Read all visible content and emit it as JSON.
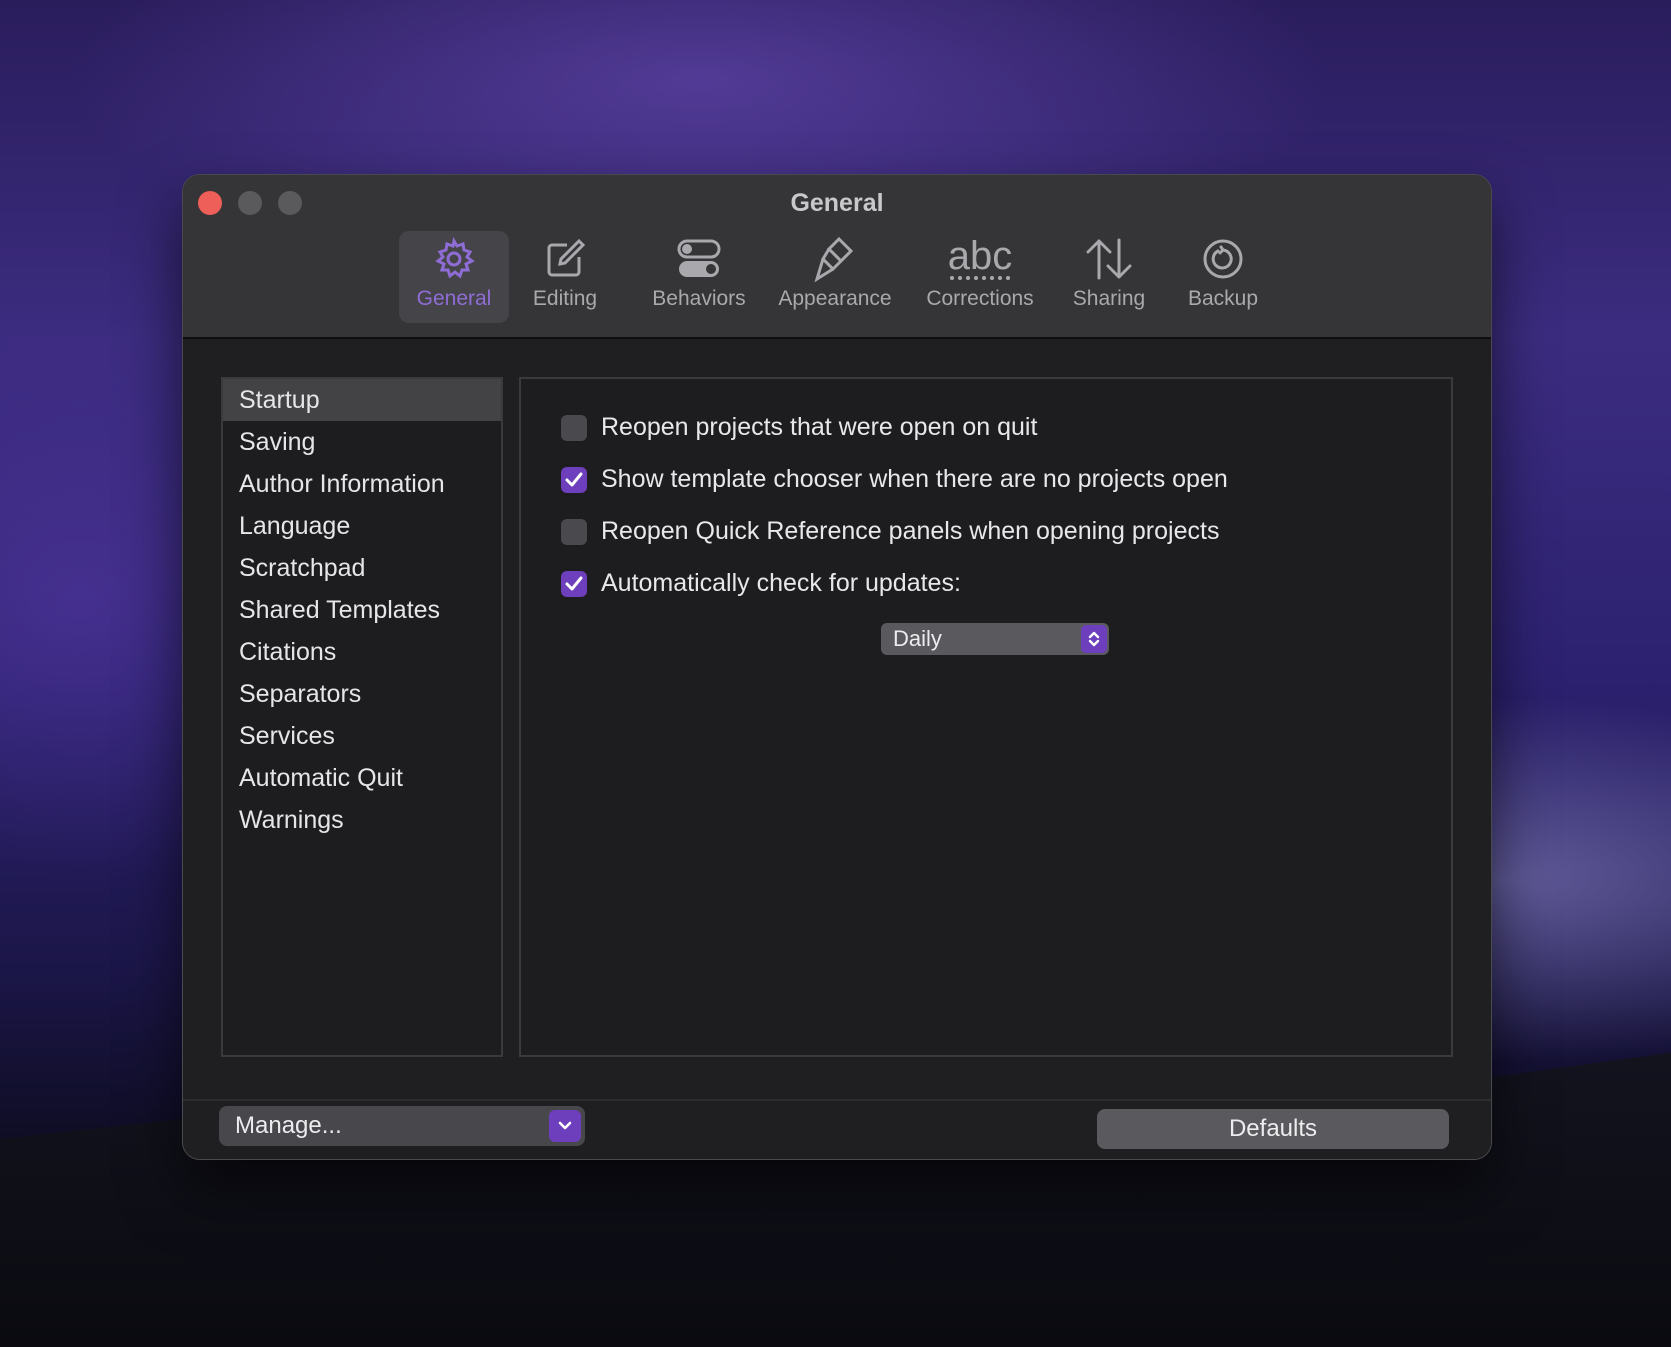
{
  "window": {
    "title": "General"
  },
  "toolbar": {
    "items": [
      {
        "label": "General",
        "icon": "gear-icon",
        "active": true
      },
      {
        "label": "Editing",
        "icon": "edit-icon"
      },
      {
        "label": "Behaviors",
        "icon": "toggles-icon"
      },
      {
        "label": "Appearance",
        "icon": "paintbrush-icon"
      },
      {
        "label": "Corrections",
        "icon": "abc-icon",
        "icon_text": "abc"
      },
      {
        "label": "Sharing",
        "icon": "arrows-updown-icon"
      },
      {
        "label": "Backup",
        "icon": "backup-clock-icon"
      }
    ]
  },
  "sidebar": {
    "items": [
      {
        "label": "Startup",
        "selected": true
      },
      {
        "label": "Saving"
      },
      {
        "label": "Author Information"
      },
      {
        "label": "Language"
      },
      {
        "label": "Scratchpad"
      },
      {
        "label": "Shared Templates"
      },
      {
        "label": "Citations"
      },
      {
        "label": "Separators"
      },
      {
        "label": "Services"
      },
      {
        "label": "Automatic Quit"
      },
      {
        "label": "Warnings"
      }
    ]
  },
  "options": [
    {
      "label": "Reopen projects that were open on quit",
      "checked": false
    },
    {
      "label": "Show template chooser when there are no projects open",
      "checked": true
    },
    {
      "label": "Reopen Quick Reference panels when opening projects",
      "checked": false
    },
    {
      "label": "Automatically check for updates:",
      "checked": true
    }
  ],
  "update_frequency": {
    "selected": "Daily"
  },
  "footer": {
    "manage_label": "Manage...",
    "defaults_label": "Defaults"
  },
  "colors": {
    "accent": "#6d3fbd",
    "active_tab_text": "#8f6cd6",
    "close": "#ed5f58"
  }
}
